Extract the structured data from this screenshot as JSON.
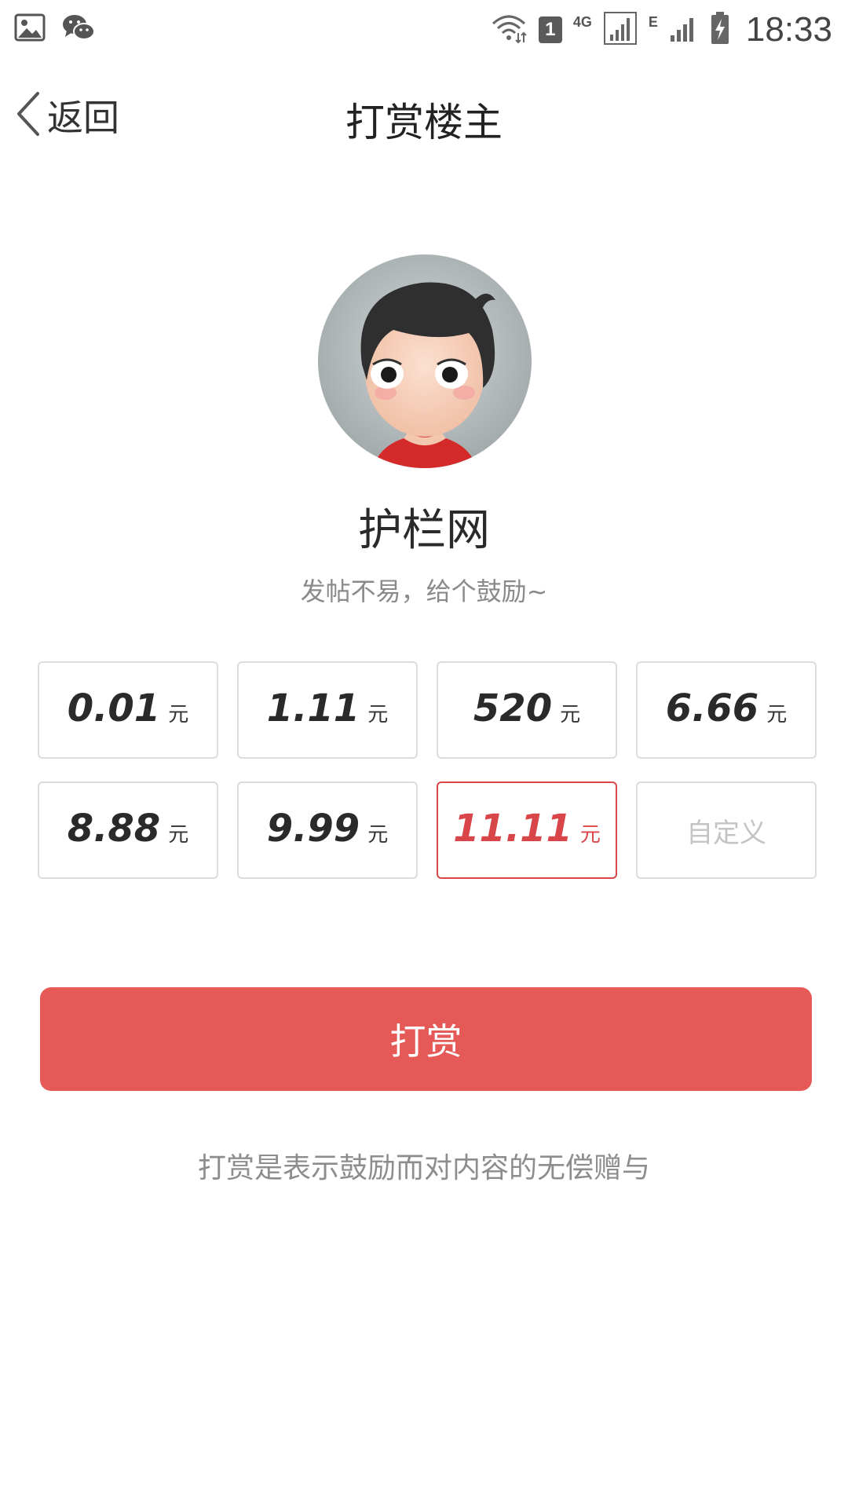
{
  "status_bar": {
    "time": "18:33",
    "sim_slot": "1",
    "network_primary": "4G",
    "network_secondary": "E",
    "icons": [
      "gallery-icon",
      "wechat-icon",
      "wifi-icon",
      "signal-icon",
      "battery-charging-icon"
    ]
  },
  "nav": {
    "back_label": "返回",
    "title": "打赏楼主"
  },
  "profile": {
    "name": "护栏网",
    "tagline": "发帖不易，给个鼓励~"
  },
  "amounts": [
    {
      "value": "0.01",
      "unit": "元",
      "selected": false
    },
    {
      "value": "1.11",
      "unit": "元",
      "selected": false
    },
    {
      "value": "520",
      "unit": "元",
      "selected": false
    },
    {
      "value": "6.66",
      "unit": "元",
      "selected": false
    },
    {
      "value": "8.88",
      "unit": "元",
      "selected": false
    },
    {
      "value": "9.99",
      "unit": "元",
      "selected": false
    },
    {
      "value": "11.11",
      "unit": "元",
      "selected": true
    }
  ],
  "custom_amount": {
    "label": "自定义"
  },
  "submit": {
    "label": "打赏"
  },
  "disclaimer": "打赏是表示鼓励而对内容的无偿赠与",
  "colors": {
    "accent": "#e55a57",
    "selected_text": "#d9464a",
    "border": "#dcdcdc",
    "muted_text": "#8d8d8d"
  }
}
